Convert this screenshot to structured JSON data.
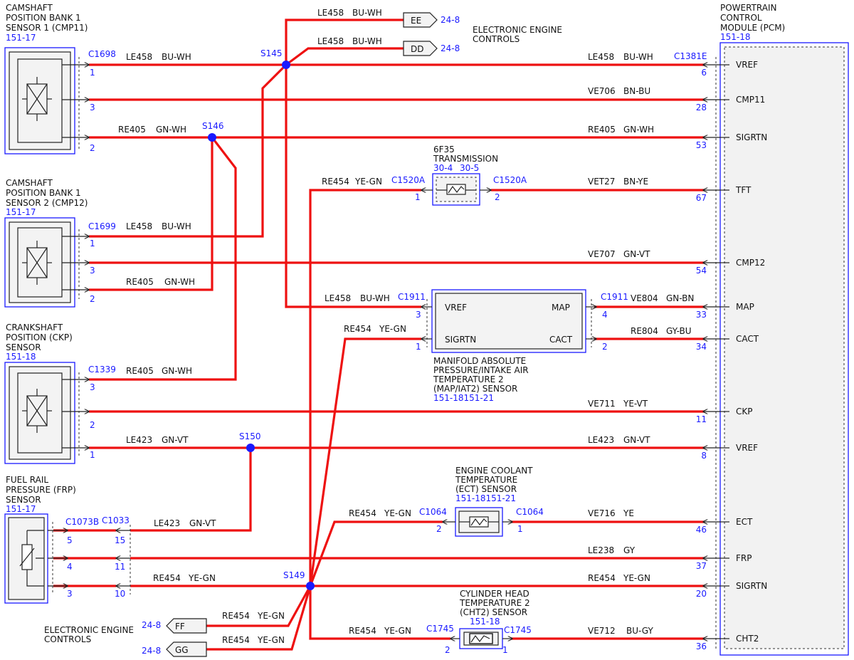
{
  "components": {
    "cmp11": {
      "lines": [
        "CAMSHAFT",
        "POSITION BANK 1",
        "SENSOR 1 (CMP11)"
      ],
      "ref": "151-17",
      "connector": "C1698",
      "pins": [
        "1",
        "3",
        "2"
      ]
    },
    "cmp12": {
      "lines": [
        "CAMSHAFT",
        "POSITION BANK 1",
        "SENSOR 2 (CMP12)"
      ],
      "ref": "151-17",
      "connector": "C1699",
      "pins": [
        "1",
        "3",
        "2"
      ]
    },
    "ckp": {
      "lines": [
        "CRANKSHAFT",
        "POSITION (CKP)",
        "SENSOR"
      ],
      "ref": "151-18",
      "connector": "C1339",
      "pins": [
        "3",
        "2",
        "1"
      ]
    },
    "frp": {
      "lines": [
        "FUEL RAIL",
        "PRESSURE (FRP)",
        "SENSOR"
      ],
      "ref": "151-17",
      "connector": "C1073B",
      "connector2": "C1033",
      "pins": [
        "5",
        "4",
        "3"
      ],
      "pins2": [
        "15",
        "11",
        "10"
      ]
    },
    "pcm": {
      "lines": [
        "POWERTRAIN",
        "CONTROL",
        "MODULE (PCM)"
      ],
      "ref": "151-18",
      "connector": "C1381E"
    },
    "trans": {
      "lines": [
        "6F35",
        "TRANSMISSION"
      ],
      "ref1": "30-4",
      "ref2": "30-5",
      "conn_left": "C1520A",
      "conn_right": "C1520A",
      "pin_left": "1",
      "pin_right": "2"
    },
    "map": {
      "lines": [
        "MANIFOLD ABSOLUTE",
        "PRESSURE/INTAKE AIR",
        "TEMPERATURE 2",
        "(MAP/IAT2) SENSOR"
      ],
      "ref": "151-18151-21",
      "conn_left": "C1911",
      "conn_right": "C1911",
      "pins": [
        "3",
        "1",
        "4",
        "2"
      ],
      "labels": [
        "VREF",
        "SIGRTN",
        "MAP",
        "CACT"
      ]
    },
    "ect": {
      "lines": [
        "ENGINE COOLANT",
        "TEMPERATURE",
        "(ECT) SENSOR"
      ],
      "ref": "151-18151-21",
      "conn_left": "C1064",
      "conn_right": "C1064",
      "pin_left": "2",
      "pin_right": "1"
    },
    "cht2": {
      "lines": [
        "CYLINDER HEAD",
        "TEMPERATURE 2",
        "(CHT2) SENSOR"
      ],
      "ref": "151-18",
      "conn_left": "C1745",
      "conn_right": "C1745",
      "pin_left": "2",
      "pin_right": "1"
    }
  },
  "offpage": {
    "ee": {
      "label": "EE",
      "ref": "24-8"
    },
    "dd": {
      "label": "DD",
      "ref": "24-8"
    },
    "ff": {
      "label": "FF",
      "ref": "24-8"
    },
    "gg": {
      "label": "GG",
      "ref": "24-8"
    },
    "eec_top": [
      "ELECTRONIC ENGINE",
      "CONTROLS"
    ],
    "eec_bottom": [
      "ELECTRONIC ENGINE",
      "CONTROLS"
    ]
  },
  "splices": [
    "S145",
    "S146",
    "S150",
    "S149"
  ],
  "pcm_pins": [
    {
      "name": "VREF",
      "pin": "6"
    },
    {
      "name": "CMP11",
      "pin": "28"
    },
    {
      "name": "SIGRTN",
      "pin": "53"
    },
    {
      "name": "TFT",
      "pin": "67"
    },
    {
      "name": "CMP12",
      "pin": "54"
    },
    {
      "name": "MAP",
      "pin": "33"
    },
    {
      "name": "CACT",
      "pin": "34"
    },
    {
      "name": "CKP",
      "pin": "11"
    },
    {
      "name": "VREF",
      "pin": "8"
    },
    {
      "name": "ECT",
      "pin": "46"
    },
    {
      "name": "FRP",
      "pin": "37"
    },
    {
      "name": "SIGRTN",
      "pin": "20"
    },
    {
      "name": "CHT2",
      "pin": "36"
    }
  ],
  "circuits": [
    {
      "code": "LE458",
      "color": "BU-WH"
    },
    {
      "code": "LE458",
      "color": "BU-WH"
    },
    {
      "code": "LE458",
      "color": "BU-WH"
    },
    {
      "code": "LE458",
      "color": "BU-WH"
    },
    {
      "code": "VE706",
      "color": "BN-BU"
    },
    {
      "code": "RE405",
      "color": "GN-WH"
    },
    {
      "code": "RE405",
      "color": "GN-WH"
    },
    {
      "code": "RE454",
      "color": "YE-GN"
    },
    {
      "code": "VET27",
      "color": "BN-YE"
    },
    {
      "code": "LE458",
      "color": "BU-WH"
    },
    {
      "code": "VE707",
      "color": "GN-VT"
    },
    {
      "code": "RE405",
      "color": "GN-WH"
    },
    {
      "code": "LE458",
      "color": "BU-WH"
    },
    {
      "code": "VE804",
      "color": "GN-BN"
    },
    {
      "code": "RE454",
      "color": "YE-GN"
    },
    {
      "code": "RE804",
      "color": "GY-BU"
    },
    {
      "code": "RE405",
      "color": "GN-WH"
    },
    {
      "code": "VE711",
      "color": "YE-VT"
    },
    {
      "code": "LE423",
      "color": "GN-VT"
    },
    {
      "code": "LE423",
      "color": "GN-VT"
    },
    {
      "code": "RE454",
      "color": "YE-GN"
    },
    {
      "code": "VE716",
      "color": "YE"
    },
    {
      "code": "LE423",
      "color": "GN-VT"
    },
    {
      "code": "LE238",
      "color": "GY"
    },
    {
      "code": "RE454",
      "color": "YE-GN"
    },
    {
      "code": "RE454",
      "color": "YE-GN"
    },
    {
      "code": "RE454",
      "color": "YE-GN"
    },
    {
      "code": "RE454",
      "color": "YE-GN"
    },
    {
      "code": "RE454",
      "color": "YE-GN"
    },
    {
      "code": "VE712",
      "color": "BU-GY"
    }
  ],
  "colors": {
    "wire": "#ee1111",
    "accent": "#1a1aff"
  }
}
